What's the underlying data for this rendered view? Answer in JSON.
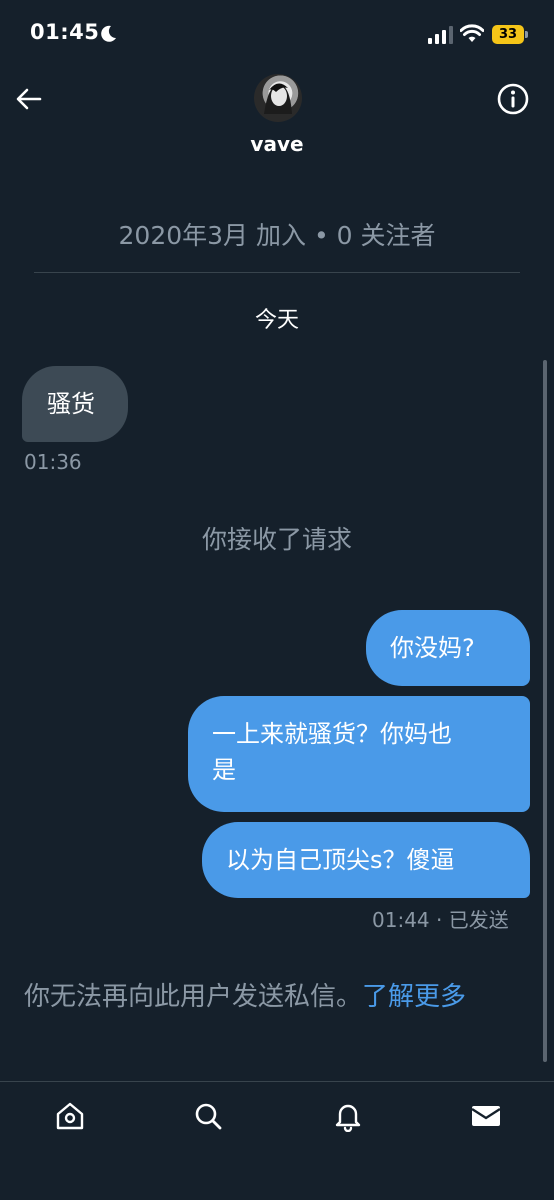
{
  "status_bar": {
    "time": "01:45",
    "battery": "33"
  },
  "header": {
    "username": "vave"
  },
  "conversation": {
    "join_info": "2020年3月 加入 • 0 关注者",
    "date_label": "今天",
    "messages": [
      {
        "direction": "incoming",
        "text": "骚货",
        "time": "01:36"
      },
      {
        "direction": "outgoing",
        "text": "你没妈?"
      },
      {
        "direction": "outgoing",
        "line1": "一上来就骚货？你妈也",
        "line2": "是"
      },
      {
        "direction": "outgoing",
        "text": "以为自己顶尖s？傻逼"
      }
    ],
    "system_message": "你接收了请求",
    "sent_time": "01:44",
    "sent_status": "· 已发送"
  },
  "notice": {
    "text": "你无法再向此用户发送私信。",
    "link": "了解更多"
  },
  "colors": {
    "background": "#15202b",
    "accent": "#4a9ae8",
    "incoming_bubble": "#3d4a55",
    "muted_text": "#8b98a5"
  },
  "icons": [
    "moon-icon",
    "signal-icon",
    "wifi-icon",
    "back-icon",
    "info-icon",
    "home-icon",
    "search-icon",
    "bell-icon",
    "mail-icon"
  ]
}
